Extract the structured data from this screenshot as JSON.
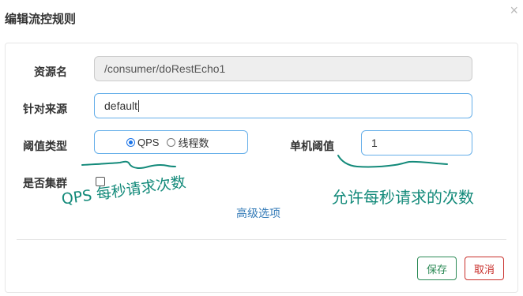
{
  "dialog": {
    "title": "编辑流控规则",
    "close_glyph": "×"
  },
  "form": {
    "resource": {
      "label": "资源名",
      "value": "/consumer/doRestEcho1"
    },
    "origin": {
      "label": "针对来源",
      "value": "default"
    },
    "threshold_type": {
      "label": "阈值类型",
      "options": [
        {
          "label": "QPS",
          "checked": true
        },
        {
          "label": "线程数",
          "checked": false
        }
      ]
    },
    "single_threshold": {
      "label": "单机阈值",
      "value": "1"
    },
    "cluster": {
      "label": "是否集群",
      "checked": false
    },
    "advanced_link": "高级选项"
  },
  "buttons": {
    "save": "保存",
    "cancel": "取消"
  },
  "annotations": {
    "left_note": "QPS 每秒请求次数",
    "right_note": "允许每秒请求的次数",
    "ink_color": "#138a7a"
  },
  "colors": {
    "focus_border": "#66afe9",
    "save": "#2e8b57",
    "cancel": "#c9302c",
    "link": "#337ab7"
  }
}
